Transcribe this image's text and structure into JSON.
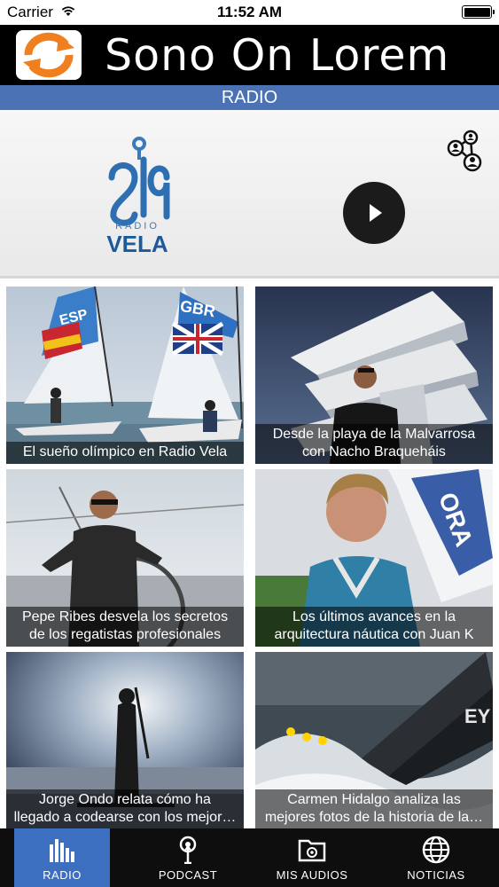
{
  "status_bar": {
    "carrier": "Carrier",
    "time": "11:52 AM",
    "wifi_icon": "wifi-icon",
    "battery_icon": "battery-icon"
  },
  "header": {
    "title": "Sono On Lorem",
    "refresh_icon": "refresh-icon",
    "colors": {
      "background": "#000000",
      "refresh_accent": "#f07f1f"
    }
  },
  "section": {
    "title": "RADIO",
    "color": "#4a72b5"
  },
  "player": {
    "station_logo_line1": "RADIO",
    "station_logo_line2": "VELA",
    "play_icon": "play-icon",
    "share_icon": "share-network-icon"
  },
  "grid": {
    "items": [
      {
        "caption_line1": "El sueño olímpico en Radio Vela",
        "caption_line2": "",
        "sail_label_1": "ESP",
        "sail_label_2": "GBR"
      },
      {
        "caption_line1": "Desde la playa de la Malvarrosa",
        "caption_line2": "con Nacho Braqueháis"
      },
      {
        "caption_line1": "Pepe Ribes desvela los secretos",
        "caption_line2": "de los regatistas profesionales"
      },
      {
        "caption_line1": "Los últimos avances en la",
        "caption_line2": "arquitectura náutica con Juan K",
        "banner_text": "ORA"
      },
      {
        "caption_line1": "Jorge Ondo relata cómo ha",
        "caption_line2": "llegado a codearse con los mejor…"
      },
      {
        "caption_line1": "Carmen Hidalgo analiza las",
        "caption_line2": "mejores fotos de la historia de la…"
      }
    ]
  },
  "tab_bar": {
    "tabs": [
      {
        "label": "RADIO",
        "icon": "equalizer-icon",
        "active": true
      },
      {
        "label": "PODCAST",
        "icon": "podcast-antenna-icon",
        "active": false
      },
      {
        "label": "MIS AUDIOS",
        "icon": "folder-audio-icon",
        "active": false
      },
      {
        "label": "NOTICIAS",
        "icon": "globe-icon",
        "active": false
      }
    ],
    "active_color": "#3d6fc0"
  }
}
